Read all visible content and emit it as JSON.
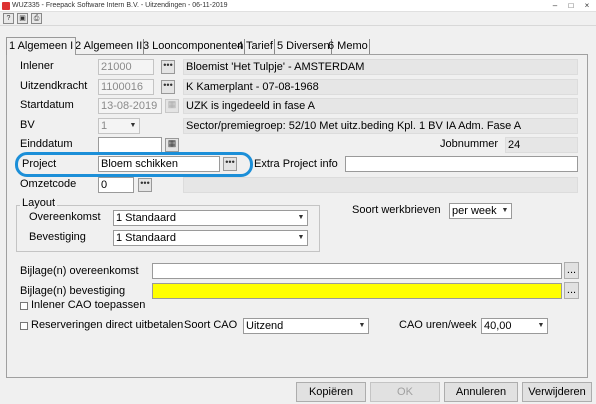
{
  "window": {
    "title": "WUZ335  -  Freepack Software Intern B.V.  -  Uitzendingen  -  06-11-2019",
    "controls": [
      "–",
      "□",
      "×"
    ]
  },
  "toolbar": {
    "buttons": [
      {
        "icon": "help-icon",
        "glyph": "?"
      },
      {
        "icon": "save-icon",
        "glyph": "▣"
      },
      {
        "icon": "print-icon",
        "glyph": "⎙"
      }
    ]
  },
  "tabs": [
    {
      "label": "1 Algemeen I",
      "active": true
    },
    {
      "label": "2 Algemeen II"
    },
    {
      "label": "3 Looncomponenten"
    },
    {
      "label": "4 Tarief"
    },
    {
      "label": "5 Diversen"
    },
    {
      "label": "6 Memo"
    }
  ],
  "form": {
    "inlener": {
      "label": "Inlener",
      "value": "21000",
      "info": "Bloemist 'Het Tulpje'  -  AMSTERDAM"
    },
    "uitzendkracht": {
      "label": "Uitzendkracht",
      "value": "1100016",
      "info": "K Kamerplant  -  07-08-1968"
    },
    "startdatum": {
      "label": "Startdatum",
      "value": "13-08-2019",
      "info": "UZK is ingedeeld in fase A"
    },
    "bv": {
      "label": "BV",
      "value": "1",
      "info": "Sector/premiegroep: 52/10  Met uitz.beding   Kpl. 1 BV IA   Adm. Fase A"
    },
    "einddatum": {
      "label": "Einddatum",
      "value": ""
    },
    "jobnummer": {
      "label": "Jobnummer",
      "value": "24"
    },
    "project": {
      "label": "Project",
      "value": "Bloem schikken"
    },
    "extra_project_info": {
      "label": "Extra Project info",
      "value": ""
    },
    "omzetcode": {
      "label": "Omzetcode",
      "value": "0"
    },
    "layout": {
      "label": "Layout",
      "overeenkomst": {
        "label": "Overeenkomst",
        "value": "1 Standaard"
      },
      "bevestiging": {
        "label": "Bevestiging",
        "value": "1 Standaard"
      }
    },
    "soort_werkbrieven": {
      "label": "Soort werkbrieven",
      "value": "per week"
    },
    "bijlage_overeenkomst": {
      "label": "Bijlage(n) overeenkomst",
      "value": "",
      "browse": "..."
    },
    "bijlage_bevestiging": {
      "label": "Bijlage(n) bevestiging",
      "value": "",
      "browse": "...",
      "highlight_color": "#ffff00"
    },
    "inlener_cao": {
      "label": "Inlener CAO toepassen",
      "checked": false
    },
    "reserveringen": {
      "label": "Reserveringen direct uitbetalen",
      "checked": false
    },
    "soort_cao": {
      "label": "Soort CAO",
      "value": "Uitzend"
    },
    "cao_uren": {
      "label": "CAO uren/week",
      "value": "40,00"
    }
  },
  "buttons": {
    "kopieren": "Kopiëren",
    "ok": "OK",
    "annuleren": "Annuleren",
    "verwijderen": "Verwijderen"
  },
  "lookup_glyph": "•••",
  "dropdown_glyph": "▼",
  "accent_color": "#1c8fd8"
}
